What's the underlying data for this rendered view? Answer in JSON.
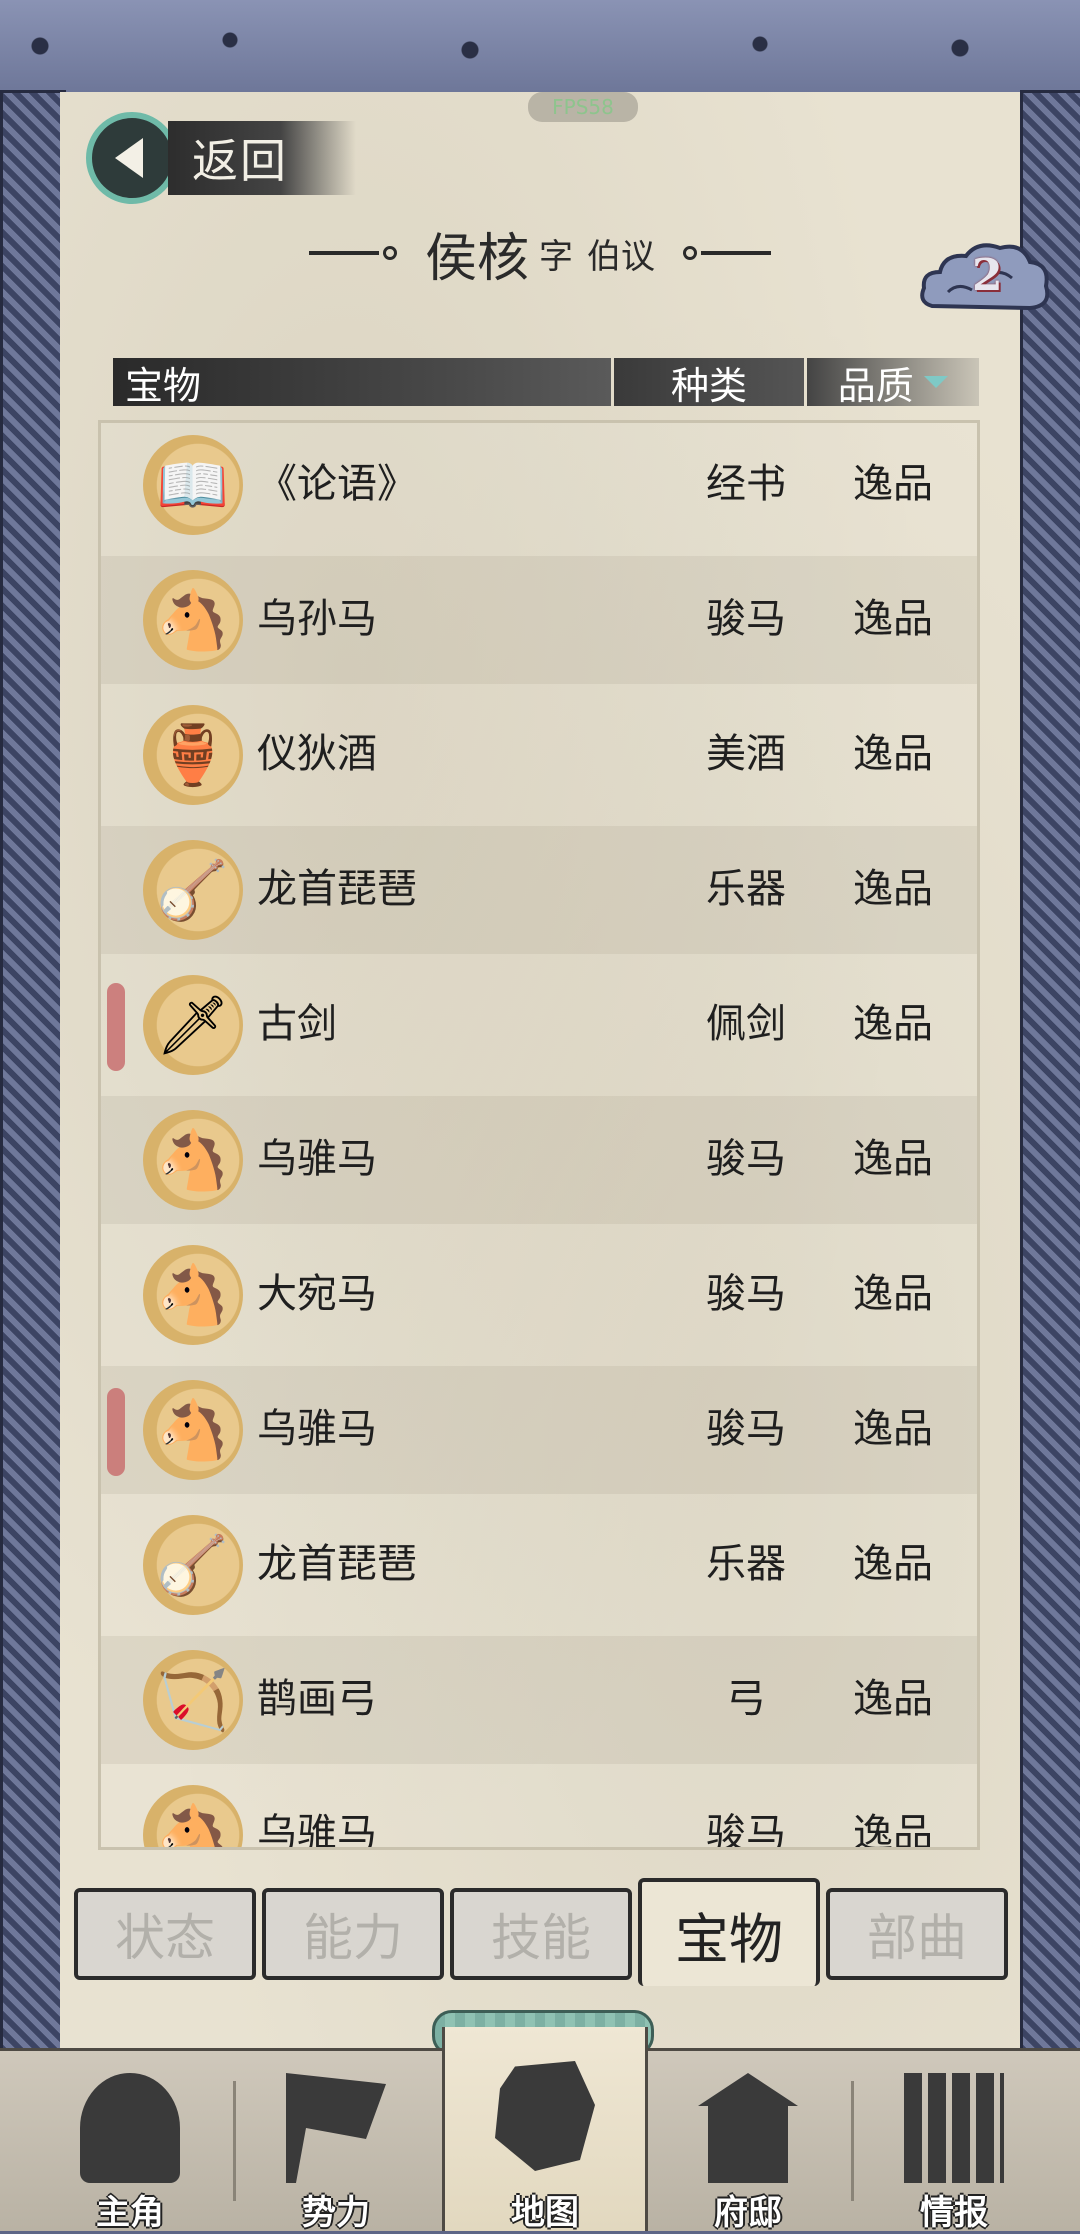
{
  "status": {
    "fps": "FPS58"
  },
  "header": {
    "back_label": "返回",
    "name": "侯核",
    "zi_label": "字",
    "zi": "伯议",
    "badge_count": "2"
  },
  "table": {
    "col_item": "宝物",
    "col_kind": "种类",
    "col_quality": "品质",
    "rows": [
      {
        "name": "《论语》",
        "kind": "经书",
        "quality": "逸品",
        "icon": "book-icon",
        "marked": false
      },
      {
        "name": "乌孙马",
        "kind": "骏马",
        "quality": "逸品",
        "icon": "horse-icon",
        "marked": false
      },
      {
        "name": "仪狄酒",
        "kind": "美酒",
        "quality": "逸品",
        "icon": "wine-jar-icon",
        "marked": false
      },
      {
        "name": "龙首琵琶",
        "kind": "乐器",
        "quality": "逸品",
        "icon": "pipa-icon",
        "marked": false
      },
      {
        "name": "古剑",
        "kind": "佩剑",
        "quality": "逸品",
        "icon": "sword-icon",
        "marked": true
      },
      {
        "name": "乌骓马",
        "kind": "骏马",
        "quality": "逸品",
        "icon": "horse-icon",
        "marked": false
      },
      {
        "name": "大宛马",
        "kind": "骏马",
        "quality": "逸品",
        "icon": "horse-icon",
        "marked": false
      },
      {
        "name": "乌骓马",
        "kind": "骏马",
        "quality": "逸品",
        "icon": "horse-icon",
        "marked": true
      },
      {
        "name": "龙首琵琶",
        "kind": "乐器",
        "quality": "逸品",
        "icon": "pipa-icon",
        "marked": false
      },
      {
        "name": "鹊画弓",
        "kind": "弓",
        "quality": "逸品",
        "icon": "bow-icon",
        "marked": false
      },
      {
        "name": "乌骓马",
        "kind": "骏马",
        "quality": "逸品",
        "icon": "horse-icon",
        "marked": false
      }
    ]
  },
  "tabs": [
    {
      "label": "状态",
      "active": false
    },
    {
      "label": "能力",
      "active": false
    },
    {
      "label": "技能",
      "active": false
    },
    {
      "label": "宝物",
      "active": true
    },
    {
      "label": "部曲",
      "active": false
    }
  ],
  "nav": [
    {
      "label": "主角",
      "active": false
    },
    {
      "label": "势力",
      "active": false
    },
    {
      "label": "地图",
      "active": true
    },
    {
      "label": "府邸",
      "active": false
    },
    {
      "label": "情报",
      "active": false
    }
  ],
  "colors": {
    "paper": "#e8e2d1",
    "frame_blue": "#5d6687",
    "accent_teal": "#6fbaa8",
    "marker_red": "#c87070"
  }
}
